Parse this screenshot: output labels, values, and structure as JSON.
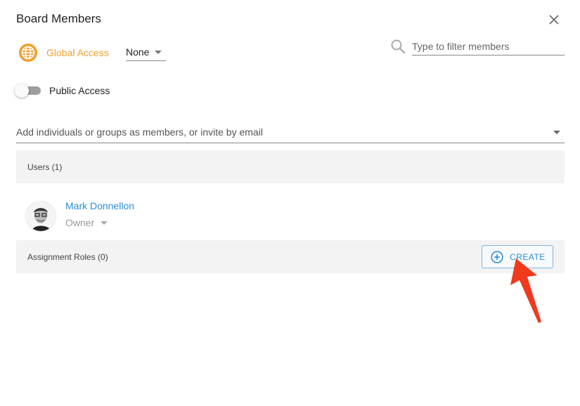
{
  "dialog": {
    "title": "Board Members",
    "close_icon": "close-icon"
  },
  "global_access": {
    "icon": "globe-icon",
    "label": "Global Access",
    "selected": "None",
    "accent_color": "#f0a030"
  },
  "filter": {
    "icon": "search-icon",
    "placeholder": "Type to filter members",
    "value": ""
  },
  "public_access": {
    "label": "Public Access",
    "enabled": false
  },
  "add_members": {
    "placeholder": "Add individuals or groups as members, or invite by email"
  },
  "users_section": {
    "label": "Users (1)",
    "members": [
      {
        "name": "Mark Donnellon",
        "role": "Owner"
      }
    ]
  },
  "roles_section": {
    "label": "Assignment Roles (0)",
    "create_label": "CREATE",
    "create_icon": "plus-circle-icon"
  },
  "annotation": {
    "icon": "red-arrow-pointer",
    "color": "#f03a1e"
  }
}
